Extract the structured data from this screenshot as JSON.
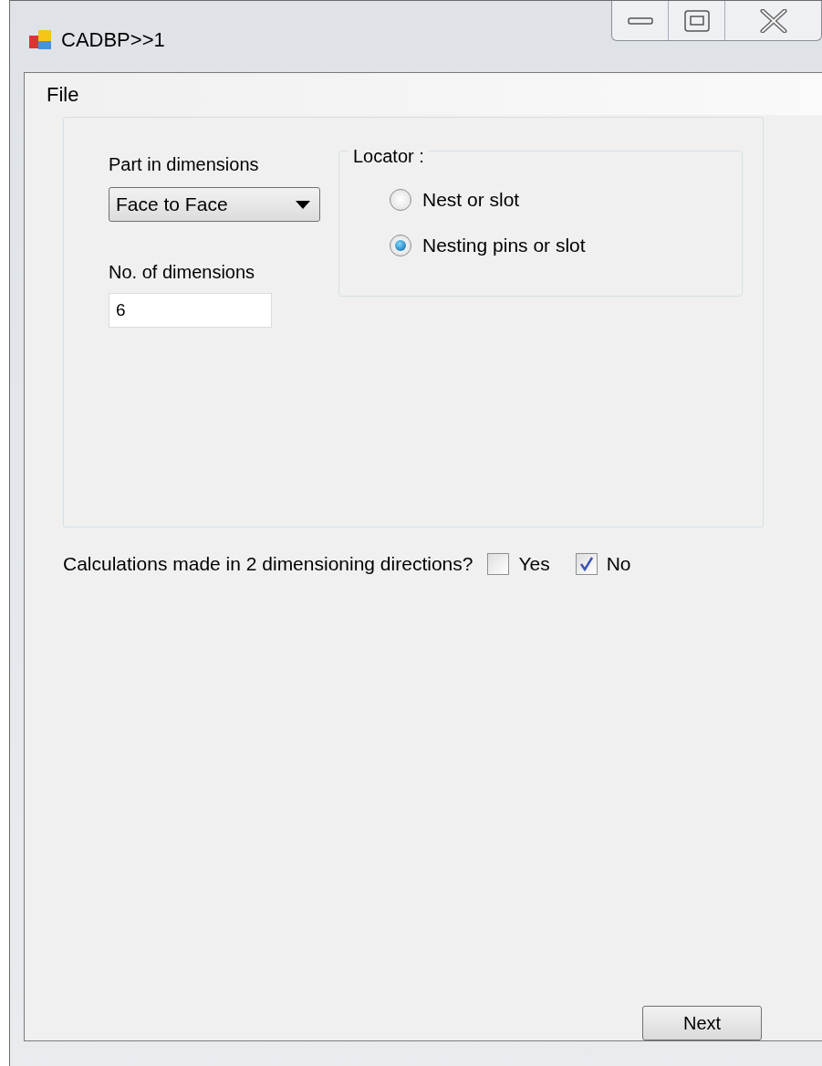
{
  "window": {
    "title": "CADBP>>1"
  },
  "menu": [
    {
      "label": "File"
    }
  ],
  "part_in_dimensions": {
    "label": "Part in dimensions",
    "value": "Face to Face"
  },
  "number_of_dimensions": {
    "label": "No. of dimensions",
    "value": "6"
  },
  "locator": {
    "title": "Locator :",
    "options": [
      {
        "label": "Nest or slot",
        "selected": false
      },
      {
        "label": "Nesting pins or slot",
        "selected": true
      }
    ]
  },
  "calculations": {
    "question": "Calculations made in 2 dimensioning directions?",
    "options": [
      {
        "label": "Yes",
        "checked": false
      },
      {
        "label": "No",
        "checked": true
      }
    ]
  },
  "buttons": [
    {
      "label": "Next"
    }
  ]
}
